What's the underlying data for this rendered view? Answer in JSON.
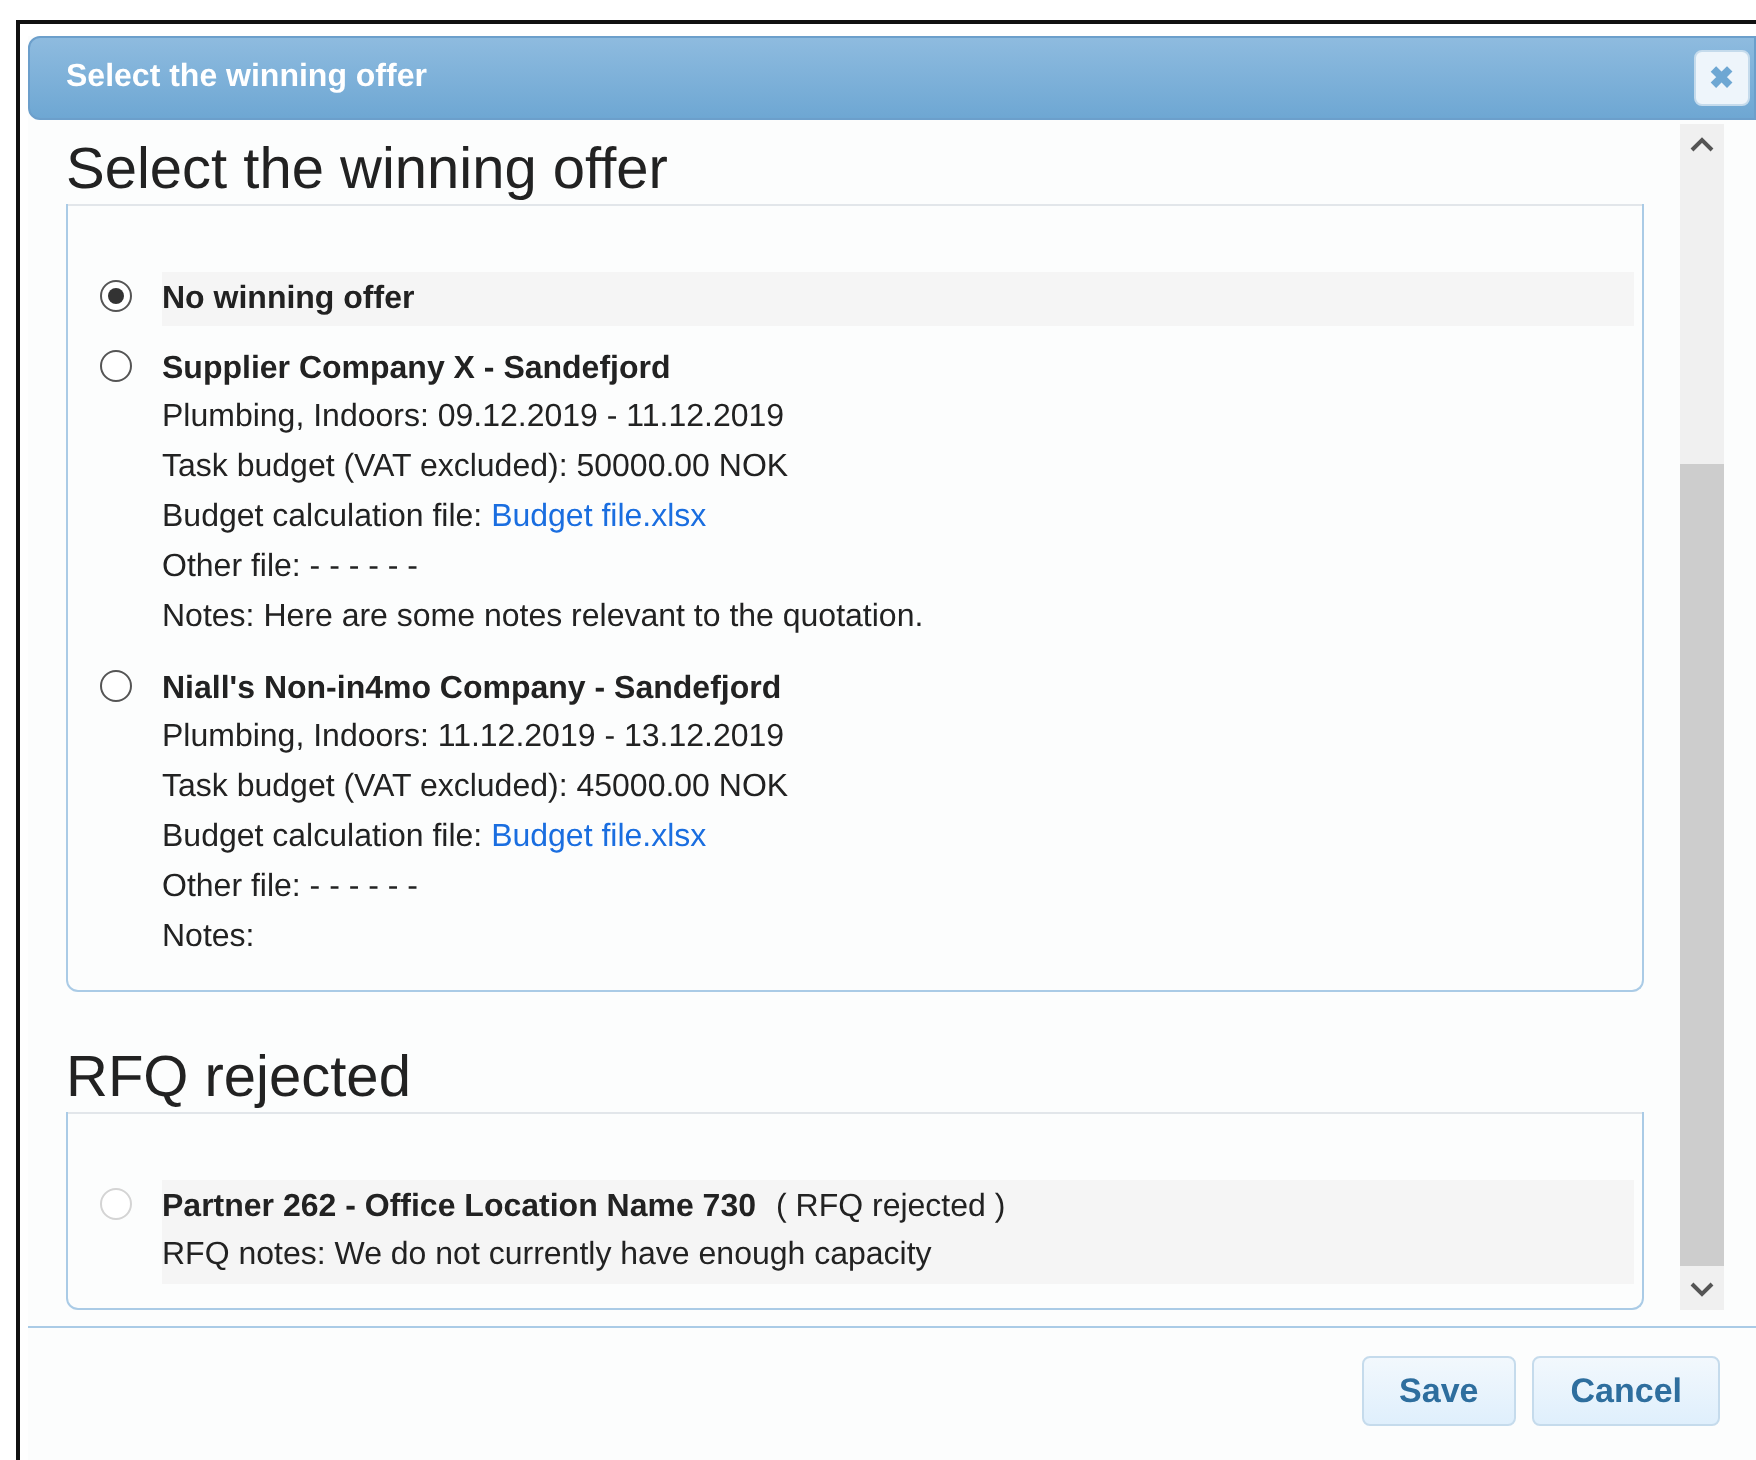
{
  "dialog": {
    "title": "Select the winning offer",
    "close_label": "✖"
  },
  "sections": [
    {
      "heading": "Select the winning offer",
      "offers": [
        {
          "title": "No winning offer",
          "selected": true,
          "disabled": false
        },
        {
          "title": "Supplier Company X - Sandefjord",
          "selected": false,
          "disabled": false,
          "lines": [
            {
              "text": "Plumbing, Indoors: 09.12.2019 - 11.12.2019"
            },
            {
              "text": "Task budget (VAT excluded): 50000.00 NOK"
            },
            {
              "text": "Budget calculation file:",
              "link": "Budget file.xlsx"
            },
            {
              "text": "Other file: - - - - - -"
            },
            {
              "text": "Notes: Here are some notes relevant to the quotation."
            }
          ]
        },
        {
          "title": "Niall's Non-in4mo Company - Sandefjord",
          "selected": false,
          "disabled": false,
          "lines": [
            {
              "text": "Plumbing, Indoors: 11.12.2019 - 13.12.2019"
            },
            {
              "text": "Task budget (VAT excluded): 45000.00 NOK"
            },
            {
              "text": "Budget calculation file:",
              "link": "Budget file.xlsx"
            },
            {
              "text": "Other file: - - - - - -"
            },
            {
              "text": "Notes:"
            }
          ]
        }
      ]
    },
    {
      "heading": "RFQ rejected",
      "offers": [
        {
          "title": "Partner 262 - Office Location Name 730",
          "status": "( RFQ rejected )",
          "selected": false,
          "disabled": true,
          "lines": [
            {
              "text": "RFQ notes: We do not currently have enough capacity"
            }
          ]
        }
      ]
    }
  ],
  "buttons": [
    "Save",
    "Cancel"
  ]
}
